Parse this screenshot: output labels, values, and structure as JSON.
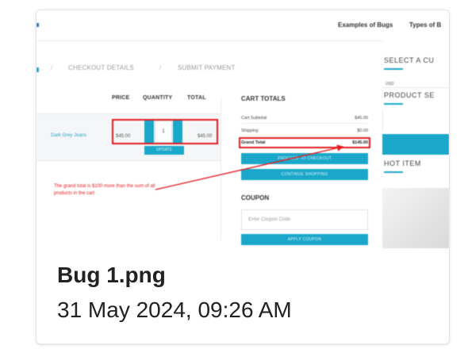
{
  "nav": {
    "links": [
      "Examples of Bugs",
      "Types of B"
    ]
  },
  "breadcrumb": {
    "steps": [
      "CHECKOUT DETAILS",
      "SUBMIT PAYMENT"
    ],
    "separators": [
      "/",
      "/"
    ]
  },
  "cart_table": {
    "headers": [
      "PRICE",
      "QUANTITY",
      "TOTAL"
    ],
    "item_name": "Dark Grey Jeans",
    "price": "$45.00",
    "quantity": "1",
    "total": "$45.00",
    "update_label": "UPDATE"
  },
  "annotation": {
    "note": "The grand total is $100 more than the sum of all products in the cart"
  },
  "cart_totals": {
    "title": "CART TOTALS",
    "rows": [
      {
        "label": "Cart Subtotal",
        "value": "$45.00"
      },
      {
        "label": "Shipping",
        "value": "$0.00"
      },
      {
        "label": "Grand Total",
        "value": "$145.00"
      }
    ],
    "checkout_label": "PROCEED TO CHECKOUT",
    "continue_label": "CONTINUE SHOPPING"
  },
  "coupon": {
    "title": "COUPON",
    "placeholder": "Enter Coupon Code",
    "apply_label": "APPLY COUPON"
  },
  "right_column": {
    "select_title": "SELECT A CU",
    "currency": "USD",
    "product_title": "PRODUCT SE",
    "hot_title": "HOT ITEM"
  },
  "caption": {
    "filename": "Bug 1.png",
    "date": "31 May 2024, 09:26 AM"
  },
  "colors": {
    "accent": "#1aa7c9",
    "highlight": "#e21c21"
  }
}
